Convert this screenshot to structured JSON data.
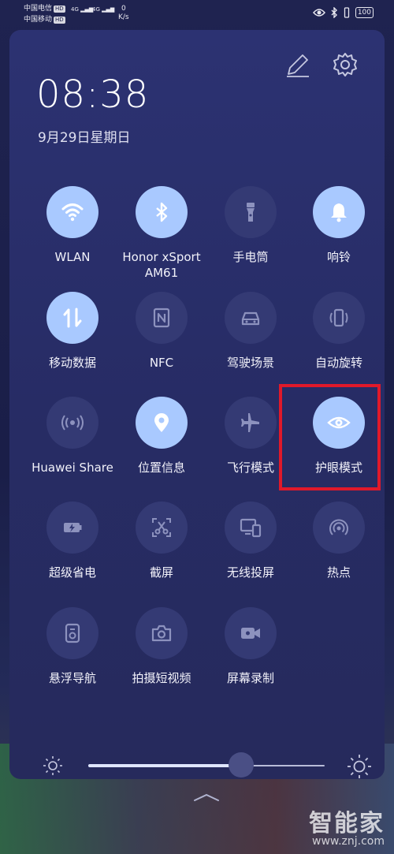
{
  "status_bar": {
    "carrier1": "中国电信",
    "carrier2": "中国移动",
    "hd": "HD",
    "net1": "4G",
    "net2": "4G",
    "speed_value": "0",
    "speed_unit": "K/s",
    "battery": "100"
  },
  "header": {
    "time": "08:38",
    "date": "9月29日星期日"
  },
  "tiles": [
    {
      "label": "WLAN",
      "icon": "wifi-icon",
      "on": true
    },
    {
      "label": "Honor xSport AM61",
      "icon": "bluetooth-icon",
      "on": true
    },
    {
      "label": "手电筒",
      "icon": "flashlight-icon",
      "on": false
    },
    {
      "label": "响铃",
      "icon": "bell-icon",
      "on": true
    },
    {
      "label": "移动数据",
      "icon": "mobile-data-icon",
      "on": true
    },
    {
      "label": "NFC",
      "icon": "nfc-icon",
      "on": false
    },
    {
      "label": "驾驶场景",
      "icon": "car-icon",
      "on": false
    },
    {
      "label": "自动旋转",
      "icon": "rotate-icon",
      "on": false
    },
    {
      "label": "Huawei Share",
      "icon": "huawei-share-icon",
      "on": false
    },
    {
      "label": "位置信息",
      "icon": "location-icon",
      "on": true
    },
    {
      "label": "飞行模式",
      "icon": "airplane-icon",
      "on": false
    },
    {
      "label": "护眼模式",
      "icon": "eye-icon",
      "on": true
    },
    {
      "label": "超级省电",
      "icon": "battery-saver-icon",
      "on": false
    },
    {
      "label": "截屏",
      "icon": "screenshot-icon",
      "on": false
    },
    {
      "label": "无线投屏",
      "icon": "cast-icon",
      "on": false
    },
    {
      "label": "热点",
      "icon": "hotspot-icon",
      "on": false
    },
    {
      "label": "悬浮导航",
      "icon": "floating-nav-icon",
      "on": false
    },
    {
      "label": "拍摄短视频",
      "icon": "camera-icon",
      "on": false
    },
    {
      "label": "屏幕录制",
      "icon": "screen-record-icon",
      "on": false
    }
  ],
  "brightness": {
    "level": 0.645
  },
  "watermark": {
    "brand": "智能家",
    "site": "www.znj.com"
  },
  "colors": {
    "tile_on": "#a9c9ff",
    "tile_off": "#343a74",
    "highlight": "#e0192a"
  }
}
